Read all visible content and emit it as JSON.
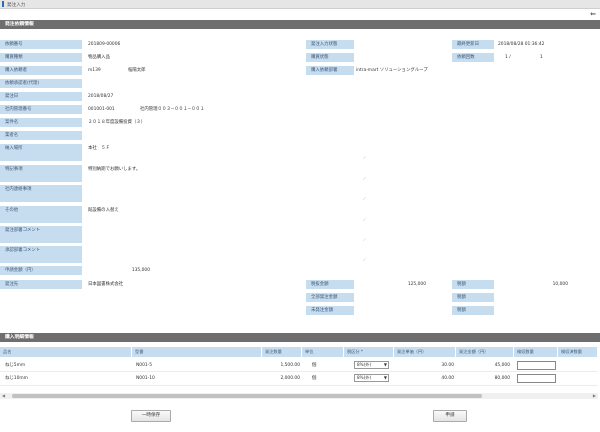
{
  "header": {
    "title": "発注入力"
  },
  "sections": {
    "order_info": "発注依頼情報",
    "item_info": "購入明細情報"
  },
  "order": {
    "order_no_label": "依頼番号",
    "order_no": "201809-00006",
    "req_type_label": "購買種類",
    "req_type": "物品購入品",
    "purchaser_label": "購入依頼者",
    "purchaser_id": "m139",
    "purchaser_name": "桜陽太郎",
    "approver_label": "依頼承認者(代理)",
    "order_date_label": "発注日",
    "order_date": "2018/08/27",
    "internal_no_label": "社内管理番号",
    "internal_no": "001001-001",
    "internal_code": "社内管理００３−００１−００１",
    "subject_label": "案件名",
    "subject": "２０１８年度設備投資（３）",
    "company_label": "業者名",
    "company": "",
    "delivery_label": "納入場所",
    "delivery": "本社　５Ｆ",
    "special_label": "特記事項",
    "special": "特別納期でお願いします。",
    "contact_label": "社内連絡事項",
    "contact": "",
    "other_label": "その他",
    "other": "既設備の入替え",
    "order_comment_label": "発注部署コメント",
    "approve_comment_label": "承認部署コメント",
    "request_amount_label": "申請金額（円）",
    "request_amount": "135,000",
    "vendor_label": "発注先",
    "vendor": "日本図書株式会社",
    "status_label": "発注入力状態",
    "status": "",
    "progress_label": "購買状態",
    "progress": "",
    "dept_label": "購入依頼部署",
    "dept": "intra-mart ソリューショングループ",
    "last_update_label": "最終更新日",
    "last_update": "2018/08/28 01:36:42",
    "count_label": "依頼回数",
    "count_a": "1 /",
    "count_b": "1",
    "tax_excl_label": "税抜金額",
    "tax_excl": "125,000",
    "tax_rate_label": "税額",
    "tax_rate": "10,000",
    "total_label": "全部発注金額",
    "total": "",
    "total_tax_label": "税額",
    "total_tax": "",
    "unit_total_label": "未発注金額",
    "unit_total": "",
    "unit_tax_label": "税額",
    "unit_tax": ""
  },
  "items": {
    "columns": [
      "品名",
      "型番",
      "発注数量",
      "単位",
      "税区分 *",
      "発注単価（円）",
      "発注金額（円）",
      "検収数量",
      "検収済数量"
    ],
    "rows": [
      {
        "name": "ねじ5mm",
        "model": "N001-5",
        "qty": "1,500.00",
        "unit": "個",
        "tax": "8%(外)",
        "price": "30.00",
        "amount": "45,000",
        "accept": ""
      },
      {
        "name": "ねじ10mm",
        "model": "N001-10",
        "qty": "2,000.00",
        "unit": "個",
        "tax": "8%(外)",
        "price": "40.00",
        "amount": "80,000",
        "accept": ""
      }
    ]
  },
  "buttons": {
    "temp_save": "一時保存",
    "apply": "申請",
    "back": "⇐"
  }
}
